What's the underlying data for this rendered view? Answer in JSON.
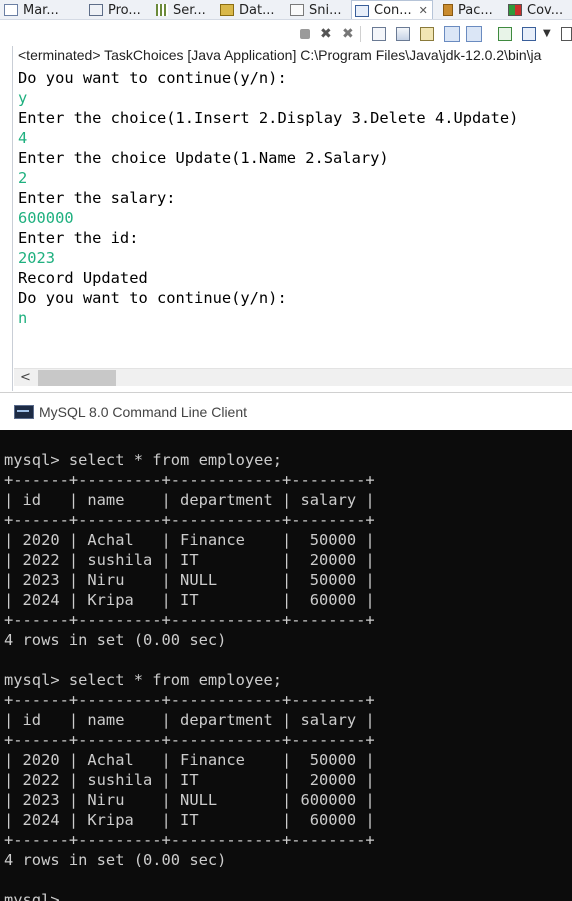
{
  "eclipse": {
    "tabs": [
      {
        "label": "Mar...",
        "icon": "markers-icon",
        "active": false
      },
      {
        "label": "Pro...",
        "icon": "properties-icon",
        "active": false
      },
      {
        "label": "Ser...",
        "icon": "servers-icon",
        "active": false
      },
      {
        "label": "Dat...",
        "icon": "data-source-explorer-icon",
        "active": false
      },
      {
        "label": "Sni...",
        "icon": "snippets-icon",
        "active": false
      },
      {
        "label": "Con...",
        "icon": "console-icon",
        "active": true
      },
      {
        "label": "Pac...",
        "icon": "package-explorer-icon",
        "active": false
      },
      {
        "label": "Cov...",
        "icon": "coverage-icon",
        "active": false
      }
    ],
    "toolbar_icons": [
      "terminate-icon",
      "remove-launch-icon",
      "remove-all-terminated-icon",
      "scroll-lock-icon",
      "word-wrap-icon",
      "show-console-icon",
      "pin-console-icon",
      "display-selected-console-icon",
      "open-console-icon",
      "view-menu-icon",
      "minimize-icon"
    ],
    "console_header": "<terminated> TaskChoices [Java Application] C:\\Program Files\\Java\\jdk-12.0.2\\bin\\ja",
    "console_lines": [
      {
        "text": "Do you want to continue(y/n):",
        "kind": "out"
      },
      {
        "text": "y",
        "kind": "in"
      },
      {
        "text": "Enter the choice(1.Insert 2.Display 3.Delete 4.Update)",
        "kind": "out"
      },
      {
        "text": "4",
        "kind": "in"
      },
      {
        "text": "Enter the choice Update(1.Name 2.Salary)",
        "kind": "out"
      },
      {
        "text": "2",
        "kind": "in"
      },
      {
        "text": "Enter the salary:",
        "kind": "out"
      },
      {
        "text": "600000",
        "kind": "in"
      },
      {
        "text": "Enter the id:",
        "kind": "out"
      },
      {
        "text": "2023",
        "kind": "in"
      },
      {
        "text": "Record Updated",
        "kind": "out"
      },
      {
        "text": "Do you want to continue(y/n):",
        "kind": "out"
      },
      {
        "text": "n",
        "kind": "in"
      }
    ],
    "colors": {
      "user_input": "#1fb07f"
    }
  },
  "mysql": {
    "title": "MySQL 8.0 Command Line Client",
    "lines": [
      "mysql> select * from employee;",
      "+------+---------+------------+--------+",
      "| id   | name    | department | salary |",
      "+------+---------+------------+--------+",
      "| 2020 | Achal   | Finance    |  50000 |",
      "| 2022 | sushila | IT         |  20000 |",
      "| 2023 | Niru    | NULL       |  50000 |",
      "| 2024 | Kripa   | IT         |  60000 |",
      "+------+---------+------------+--------+",
      "4 rows in set (0.00 sec)",
      "",
      "mysql> select * from employee;",
      "+------+---------+------------+--------+",
      "| id   | name    | department | salary |",
      "+------+---------+------------+--------+",
      "| 2020 | Achal   | Finance    |  50000 |",
      "| 2022 | sushila | IT         |  20000 |",
      "| 2023 | Niru    | NULL       | 600000 |",
      "| 2024 | Kripa   | IT         |  60000 |",
      "+------+---------+------------+--------+",
      "4 rows in set (0.00 sec)",
      "",
      "mysql>"
    ]
  }
}
